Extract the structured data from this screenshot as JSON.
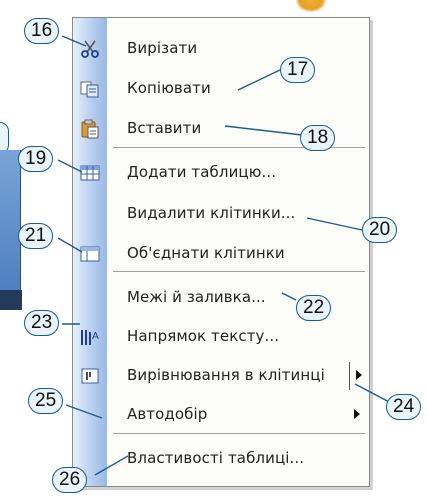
{
  "menu": {
    "items": [
      {
        "label": "Вирізати",
        "icon": "scissors-icon"
      },
      {
        "label": "Копіювати",
        "icon": "copy-icon"
      },
      {
        "label": "Вставити",
        "icon": "paste-icon"
      },
      {
        "label": "Додати таблицю...",
        "icon": "insert-table-icon"
      },
      {
        "label": "Видалити клітинки...",
        "icon": ""
      },
      {
        "label": "Об'єднати клітинки",
        "icon": "merge-cells-icon"
      },
      {
        "label": "Межі й заливка...",
        "icon": ""
      },
      {
        "label": "Напрямок тексту...",
        "icon": "text-direction-icon"
      },
      {
        "label": "Вирівнювання в клітинці",
        "icon": "cell-alignment-icon",
        "submenu": true
      },
      {
        "label": "Автодобір",
        "icon": "",
        "submenu": true
      },
      {
        "label": "Властивості таблиці...",
        "icon": ""
      }
    ]
  },
  "callouts": [
    "16",
    "17",
    "18",
    "19",
    "20",
    "21",
    "22",
    "23",
    "24",
    "25",
    "26"
  ],
  "colors": {
    "callout_border": "#1e5a8c",
    "callout_fill": "#eaf4fb",
    "gutter": "#b9cff0"
  }
}
